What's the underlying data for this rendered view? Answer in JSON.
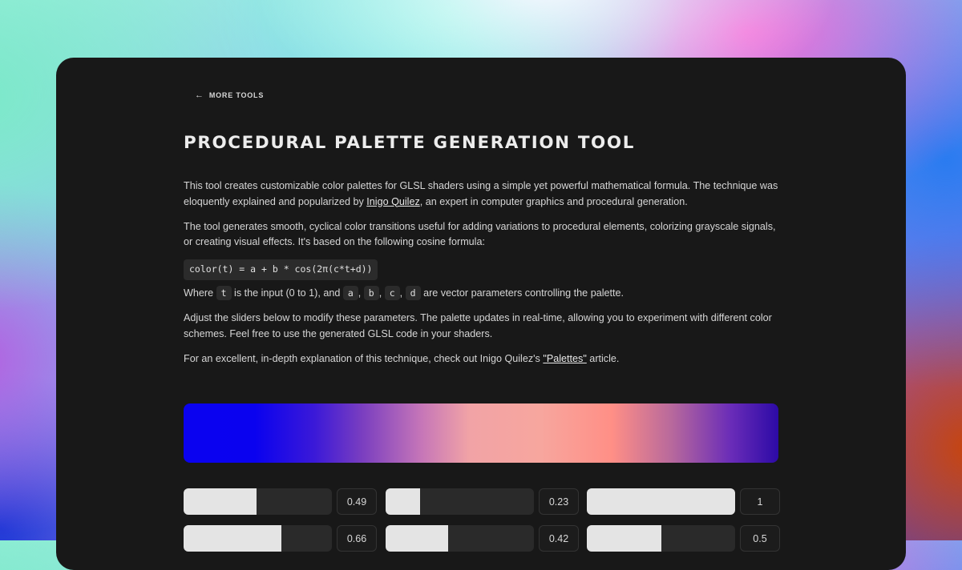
{
  "nav": {
    "back_arrow": "←",
    "back_label": "MORE TOOLS"
  },
  "page": {
    "title": "PROCEDURAL PALETTE GENERATION TOOL"
  },
  "intro": {
    "p1_before": "This tool creates customizable color palettes for GLSL shaders using a simple yet powerful mathematical formula. The technique was eloquently explained and popularized by ",
    "p1_link": "Inigo Quilez",
    "p1_after": ", an expert in computer graphics and procedural generation.",
    "p2": "The tool generates smooth, cyclical color transitions useful for adding variations to procedural elements, colorizing grayscale signals, or creating visual effects. It's based on the following cosine formula:",
    "formula": "color(t) = a + b * cos(2π(c*t+d))",
    "where_1": "Where ",
    "param_t": "t",
    "where_2": " is the input (0 to 1), and ",
    "param_a": "a",
    "param_b": "b",
    "param_c": "c",
    "param_d": "d",
    "comma": ",",
    "where_3": " are vector parameters controlling the palette.",
    "p4": "Adjust the sliders below to modify these parameters. The palette updates in real-time, allowing you to experiment with different color schemes. Feel free to use the generated GLSL code in your shaders.",
    "p5_before": "For an excellent, in-depth explanation of this technique, check out Inigo Quilez's ",
    "p5_link": "\"Palettes\"",
    "p5_after": " article."
  },
  "palette": {
    "colors": [
      "#0a02f0",
      "#3b19d8",
      "#c676b8",
      "#f7a69e",
      "#ff8f86",
      "#6a2cb8",
      "#2c0aa6"
    ]
  },
  "sliders": {
    "rows": [
      [
        {
          "value": 0.49,
          "label": "0.49"
        },
        {
          "value": 0.23,
          "label": "0.23"
        },
        {
          "value": 1,
          "label": "1"
        }
      ],
      [
        {
          "value": 0.66,
          "label": "0.66"
        },
        {
          "value": 0.42,
          "label": "0.42"
        },
        {
          "value": 0.5,
          "label": "0.5"
        }
      ]
    ]
  }
}
